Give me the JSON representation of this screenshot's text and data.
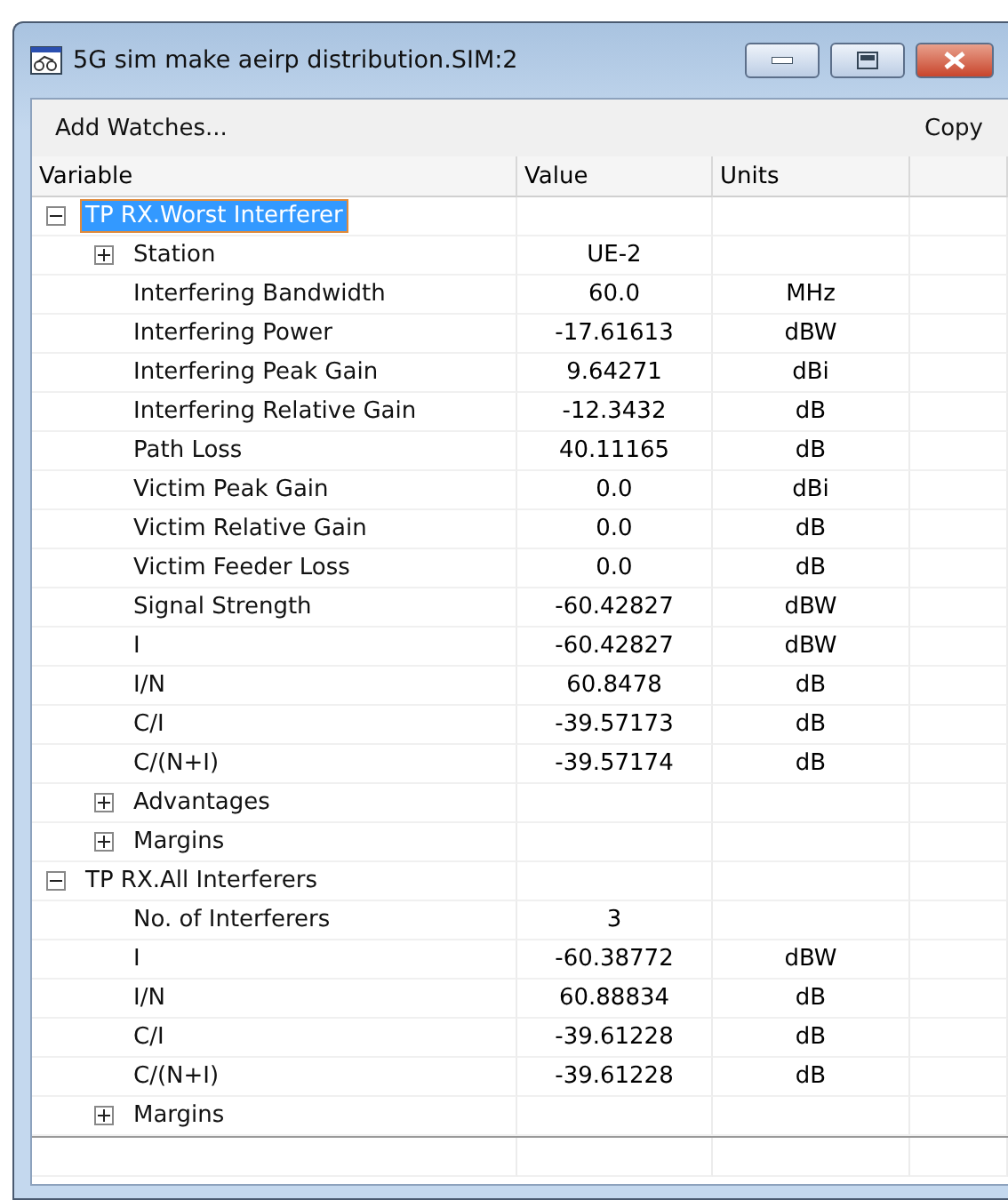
{
  "window": {
    "title": "5G sim make aeirp distribution.SIM:2"
  },
  "toolbar": {
    "left": "Add Watches...",
    "right": "Copy"
  },
  "columns": [
    "Variable",
    "Value",
    "Units"
  ],
  "tree": [
    {
      "variable": "TP RX.Worst Interferer",
      "selected": true,
      "expanded": true,
      "children": [
        {
          "variable": "Station",
          "value": "UE-2",
          "selected": false,
          "expanded": false
        },
        {
          "variable": "Interfering Bandwidth",
          "value": "60.0",
          "units": "MHz",
          "selected": false
        },
        {
          "variable": "Interfering Power",
          "value": "-17.61613",
          "units": "dBW",
          "selected": false
        },
        {
          "variable": "Interfering Peak Gain",
          "value": "9.64271",
          "units": "dBi",
          "selected": false
        },
        {
          "variable": "Interfering Relative Gain",
          "value": "-12.3432",
          "units": "dB",
          "selected": false
        },
        {
          "variable": "Path Loss",
          "value": "40.11165",
          "units": "dB",
          "selected": false
        },
        {
          "variable": "Victim Peak Gain",
          "value": "0.0",
          "units": "dBi",
          "selected": false
        },
        {
          "variable": "Victim Relative Gain",
          "value": "0.0",
          "units": "dB",
          "selected": false
        },
        {
          "variable": "Victim Feeder Loss",
          "value": "0.0",
          "units": "dB",
          "selected": false
        },
        {
          "variable": "Signal Strength",
          "value": "-60.42827",
          "units": "dBW",
          "selected": false
        },
        {
          "variable": "I",
          "value": "-60.42827",
          "units": "dBW",
          "selected": false
        },
        {
          "variable": "I/N",
          "value": "60.8478",
          "units": "dB",
          "selected": false
        },
        {
          "variable": "C/I",
          "value": "-39.57173",
          "units": "dB",
          "selected": false
        },
        {
          "variable": "C/(N+I)",
          "value": "-39.57174",
          "units": "dB",
          "selected": false
        },
        {
          "variable": "Advantages",
          "selected": false,
          "expanded": false
        },
        {
          "variable": "Margins",
          "selected": false,
          "expanded": false
        }
      ]
    },
    {
      "variable": "TP RX.All Interferers",
      "selected": false,
      "expanded": true,
      "children": [
        {
          "variable": "No. of Interferers",
          "value": "3",
          "selected": false
        },
        {
          "variable": "I",
          "value": "-60.38772",
          "units": "dBW",
          "selected": false
        },
        {
          "variable": "I/N",
          "value": "60.88834",
          "units": "dB",
          "selected": false
        },
        {
          "variable": "C/I",
          "value": "-39.61228",
          "units": "dB",
          "selected": false
        },
        {
          "variable": "C/(N+I)",
          "value": "-39.61228",
          "units": "dB",
          "selected": false
        },
        {
          "variable": "Margins",
          "selected": false,
          "expanded": false
        }
      ]
    }
  ]
}
